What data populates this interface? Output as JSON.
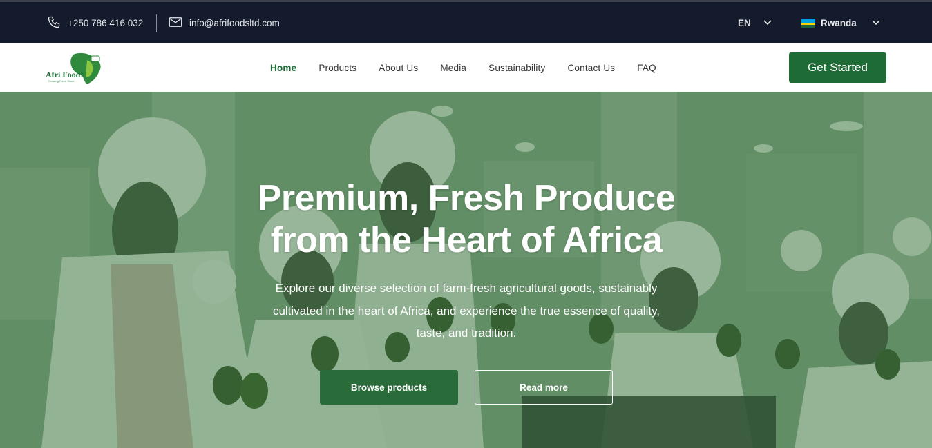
{
  "topbar": {
    "phone": "+250 786 416 032",
    "email": "info@afrifoodsltd.com",
    "language": "EN",
    "country": "Rwanda",
    "country_flag_colors": [
      "#00a1de",
      "#fad201",
      "#20603d"
    ]
  },
  "brand": {
    "logo_text": "Afri Foods",
    "logo_tagline": "Growing Fresh Since",
    "colors": {
      "primary": "#1f6b35",
      "dark": "#131b2c"
    }
  },
  "nav": {
    "items": [
      "Home",
      "Products",
      "About Us",
      "Media",
      "Sustainability",
      "Contact Us",
      "FAQ"
    ],
    "active": "Home",
    "cta_label": "Get Started"
  },
  "hero": {
    "title_line1": "Premium, Fresh Produce",
    "title_line2": "from the Heart of Africa",
    "subtitle": "Explore our diverse selection of farm-fresh agricultural goods, sustainably cultivated in the heart of Africa, and experience the true essence of quality, taste, and tradition.",
    "primary_button": "Browse products",
    "secondary_button": "Read more"
  }
}
